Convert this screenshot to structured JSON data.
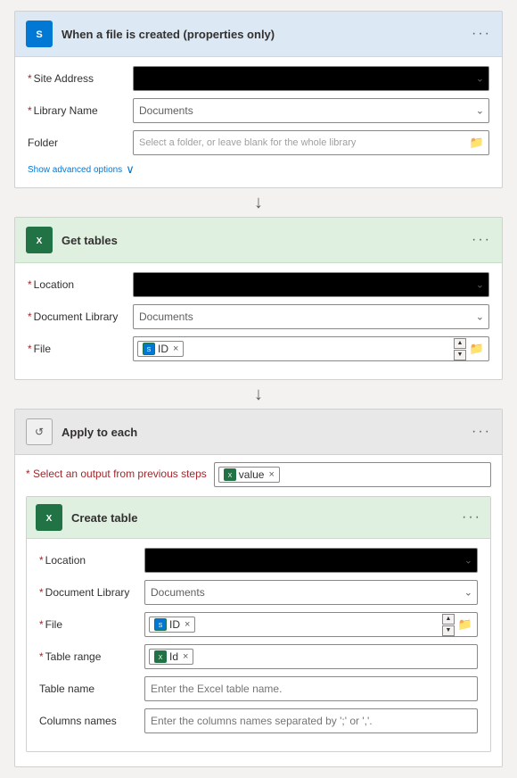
{
  "trigger": {
    "title": "When a file is created (properties only)",
    "more_label": "···",
    "fields": {
      "site_address_label": "Site Address",
      "library_name_label": "Library Name",
      "library_name_value": "Documents",
      "folder_label": "Folder",
      "folder_placeholder": "Select a folder, or leave blank for the whole library"
    },
    "advanced_link": "Show advanced options",
    "advanced_chevron": "∨"
  },
  "get_tables": {
    "title": "Get tables",
    "more_label": "···",
    "fields": {
      "location_label": "Location",
      "doc_library_label": "Document Library",
      "doc_library_value": "Documents",
      "file_label": "File",
      "file_tag": "ID"
    }
  },
  "apply_each": {
    "title": "Apply to each",
    "more_label": "···",
    "select_output_label": "* Select an output from previous steps",
    "value_tag": "value",
    "create_table": {
      "title": "Create table",
      "more_label": "···",
      "fields": {
        "location_label": "Location",
        "doc_library_label": "Document Library",
        "doc_library_value": "Documents",
        "file_label": "File",
        "file_tag": "ID",
        "table_range_label": "Table range",
        "table_range_tag": "Id",
        "table_name_label": "Table name",
        "table_name_placeholder": "Enter the Excel table name.",
        "columns_label": "Columns names",
        "columns_placeholder": "Enter the columns names separated by ';' or ','."
      }
    }
  },
  "icons": {
    "sharepoint": "S",
    "excel": "X",
    "loop": "↺",
    "arrow_down": "↓",
    "chevron_down": "⌄",
    "folder": "📁",
    "tag_excel": "X"
  }
}
